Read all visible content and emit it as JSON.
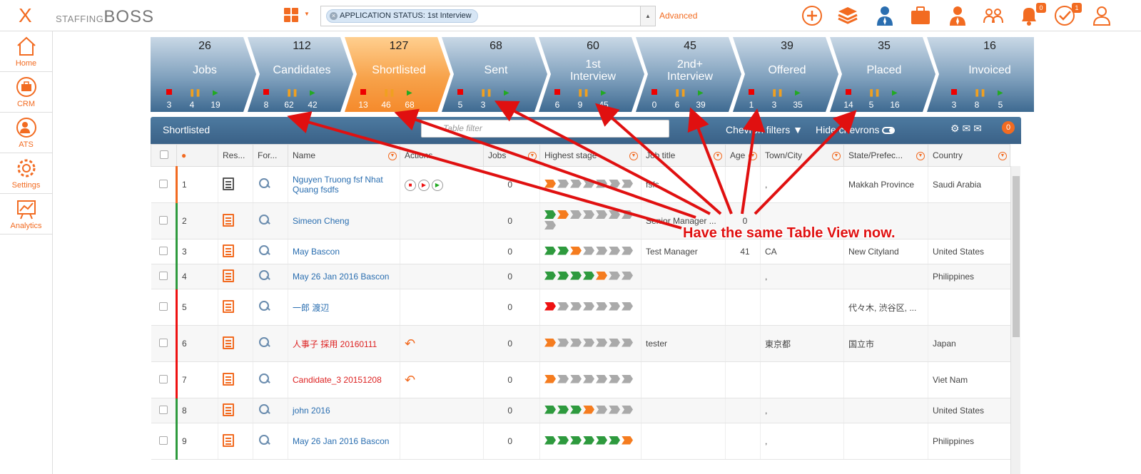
{
  "app": {
    "logo_mark": "X",
    "logo_small": "STAFFING",
    "logo_big": "BOSS"
  },
  "search": {
    "pill_label": "APPLICATION STATUS:",
    "pill_value": "1st Interview",
    "advanced_label": "Advanced"
  },
  "top_badges": {
    "notifications": "0",
    "tasks": "1"
  },
  "sidebar": {
    "items": [
      {
        "label": "Home",
        "icon": "home-icon"
      },
      {
        "label": "CRM",
        "icon": "briefcase-icon"
      },
      {
        "label": "ATS",
        "icon": "ats-icon"
      },
      {
        "label": "Settings",
        "icon": "gear-icon"
      },
      {
        "label": "Analytics",
        "icon": "chart-icon"
      }
    ]
  },
  "chevrons": [
    {
      "count": "26",
      "label": "Jobs",
      "stop": "3",
      "pause": "4",
      "play": "19",
      "active": false
    },
    {
      "count": "112",
      "label": "Candidates",
      "stop": "8",
      "pause": "62",
      "play": "42",
      "active": false
    },
    {
      "count": "127",
      "label": "Shortlisted",
      "stop": "13",
      "pause": "46",
      "play": "68",
      "active": true
    },
    {
      "count": "68",
      "label": "Sent",
      "stop": "5",
      "pause": "3",
      "play": "",
      "active": false
    },
    {
      "count": "60",
      "label": "1st Interview",
      "stop": "6",
      "pause": "9",
      "play": "45",
      "active": false
    },
    {
      "count": "45",
      "label": "2nd+ Interview",
      "stop": "0",
      "pause": "6",
      "play": "39",
      "active": false
    },
    {
      "count": "39",
      "label": "Offered",
      "stop": "1",
      "pause": "3",
      "play": "35",
      "active": false
    },
    {
      "count": "35",
      "label": "Placed",
      "stop": "14",
      "pause": "5",
      "play": "16",
      "active": false
    },
    {
      "count": "16",
      "label": "Invoiced",
      "stop": "3",
      "pause": "8",
      "play": "5",
      "active": false
    }
  ],
  "table_bar": {
    "title": "Shortlisted",
    "filter_placeholder": "Table filter",
    "chevron_filters": "Chevron filters",
    "hide_chevrons": "Hide chevrons",
    "badge": "0"
  },
  "columns": [
    "Res...",
    "For...",
    "Name",
    "Actions",
    "Jobs",
    "Highest stage",
    "Job title",
    "Age",
    "Town/City",
    "State/Prefec...",
    "Country"
  ],
  "rows": [
    {
      "num": "1",
      "name": "Nguyen Truong fsf Nhat Quang fsdfs",
      "jobs": "0",
      "stage": "ogggggg",
      "job_title": "fsfs",
      "age": "",
      "town": ",",
      "state": "Makkah Province",
      "country": "Saudi Arabia",
      "bar": "#f26b21",
      "red": false,
      "actions": "buttons"
    },
    {
      "num": "2",
      "name": "Simeon Cheng",
      "jobs": "0",
      "stage": "Gogggggg",
      "job_title": "Senior Manager ...",
      "age": "0",
      "town": "",
      "state": "",
      "country": "",
      "bar": "#2e9a3e",
      "red": false,
      "actions": ""
    },
    {
      "num": "3",
      "name": "May Bascon",
      "jobs": "0",
      "stage": "GGogggg",
      "job_title": "Test Manager",
      "age": "41",
      "town": "CA",
      "state": "New Cityland",
      "country": "United States",
      "bar": "#2e9a3e",
      "red": false,
      "actions": ""
    },
    {
      "num": "4",
      "name": "May 26 Jan 2016 Bascon",
      "jobs": "0",
      "stage": "GGGGogg",
      "job_title": "",
      "age": "",
      "town": ",",
      "state": "",
      "country": "Philippines",
      "bar": "#2e9a3e",
      "red": false,
      "actions": ""
    },
    {
      "num": "5",
      "name": "一郎 渡辺",
      "jobs": "0",
      "stage": "rgggggg",
      "job_title": "",
      "age": "",
      "town": "",
      "state": "代々木, 渋谷区, ...",
      "country": "",
      "bar": "#e11",
      "red": false,
      "actions": ""
    },
    {
      "num": "6",
      "name": "人事子 採用 20160111",
      "jobs": "0",
      "stage": "ogggggg",
      "job_title": "tester",
      "age": "",
      "town": "東京都",
      "state": "国立市",
      "country": "Japan",
      "bar": "#e11",
      "red": true,
      "actions": "reply"
    },
    {
      "num": "7",
      "name": "Candidate_3 20151208",
      "jobs": "0",
      "stage": "ogggggg",
      "job_title": "",
      "age": "",
      "town": "",
      "state": "",
      "country": "Viet Nam",
      "bar": "#e11",
      "red": true,
      "actions": "reply"
    },
    {
      "num": "8",
      "name": "john 2016",
      "jobs": "0",
      "stage": "GGGoggg",
      "job_title": "",
      "age": "",
      "town": ",",
      "state": "",
      "country": "United States",
      "bar": "#2e9a3e",
      "red": false,
      "actions": ""
    },
    {
      "num": "9",
      "name": "May 26 Jan 2016 Bascon",
      "jobs": "0",
      "stage": "GGGGGGo",
      "job_title": "",
      "age": "",
      "town": ",",
      "state": "",
      "country": "Philippines",
      "bar": "#2e9a3e",
      "red": false,
      "actions": ""
    }
  ],
  "annotation": "Have the same Table View now."
}
